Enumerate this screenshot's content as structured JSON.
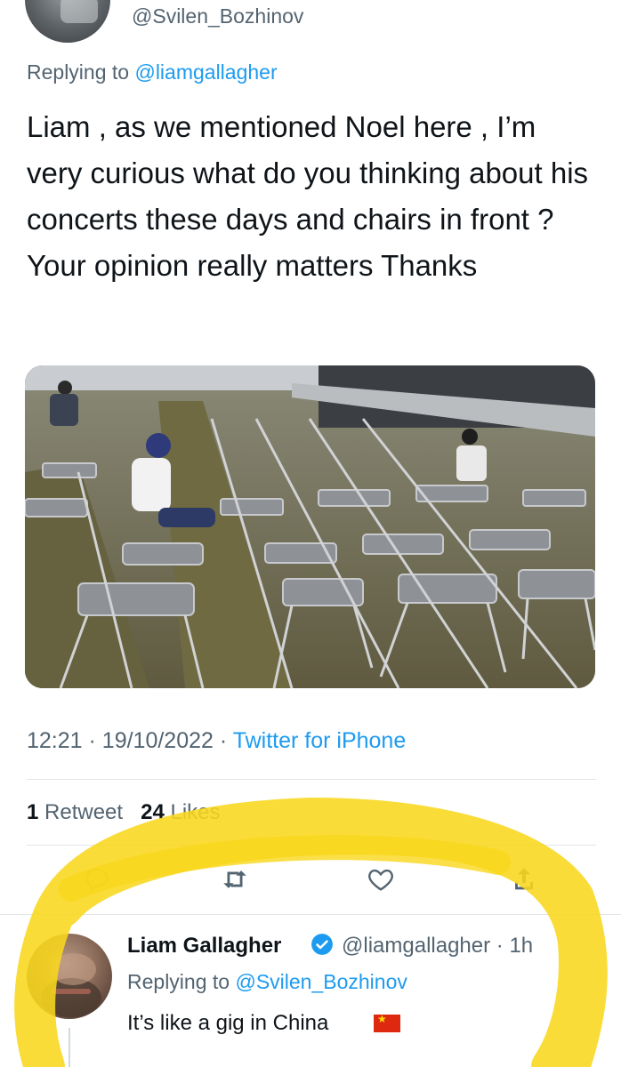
{
  "original_tweet": {
    "handle": "@Svilen_Bozhinov",
    "replying_prefix": "Replying to ",
    "replying_to": "@liamgallagher",
    "text": "Liam , as we mentioned Noel here , I’m very curious what do you thinking about his concerts these days and chairs in front ? Your opinion really matters Thanks",
    "time": "12:21",
    "date": "19/10/2022",
    "separator": "·",
    "source": "Twitter for iPhone",
    "retweets_count": "1",
    "retweets_label": "Retweet",
    "likes_count": "24",
    "likes_label": "Likes"
  },
  "actions": {
    "icons": [
      "reply-icon",
      "retweet-icon",
      "like-icon",
      "share-icon"
    ]
  },
  "reply_tweet": {
    "name": "Liam Gallagher",
    "handle": "@liamgallagher",
    "time": "· 1h",
    "replying_prefix": "Replying to ",
    "replying_to": "@Svilen_Bozhinov",
    "text": "It’s like a gig in China"
  },
  "colors": {
    "link": "#1d9bf0",
    "secondary_text": "#536471",
    "primary_text": "#0f1419",
    "highlighter": "#f9d71c",
    "divider": "#e1e6ea"
  }
}
